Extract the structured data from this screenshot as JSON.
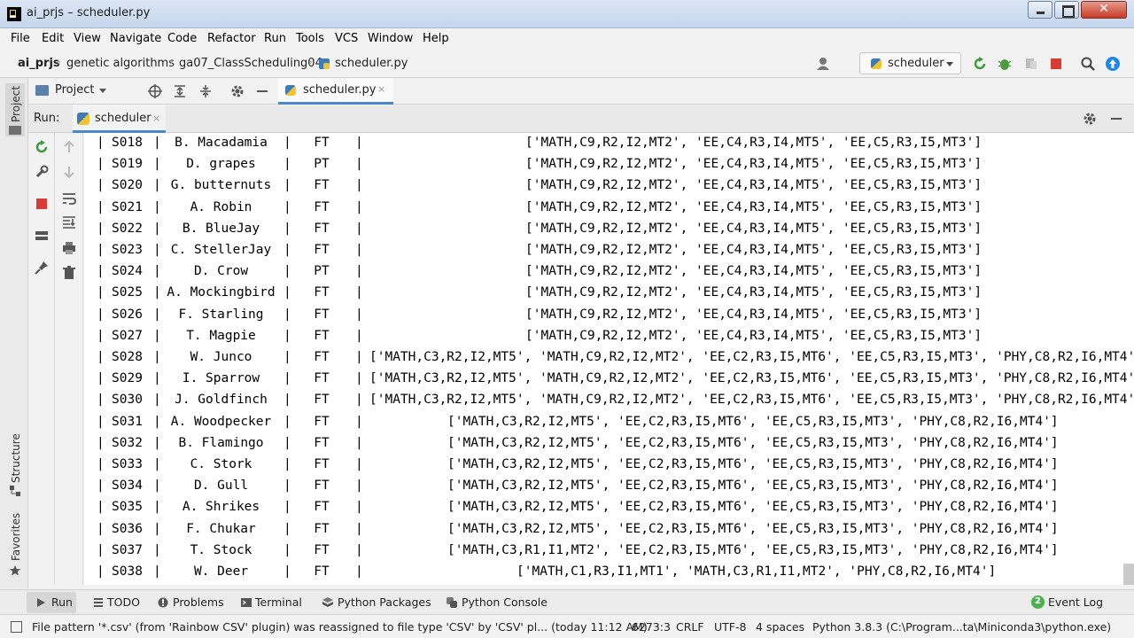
{
  "window": {
    "title": "ai_prjs – scheduler.py",
    "close_glyph": "✕"
  },
  "menu": [
    "File",
    "Edit",
    "View",
    "Navigate",
    "Code",
    "Refactor",
    "Run",
    "Tools",
    "VCS",
    "Window",
    "Help"
  ],
  "breadcrumb": [
    "ai_prjs",
    "genetic algorithms",
    "ga07_ClassScheduling04",
    "scheduler.py"
  ],
  "run_config": "scheduler",
  "left_strip": {
    "project": "Project",
    "structure": "Structure",
    "favorites": "Favorites"
  },
  "project_panel": {
    "label": "Project"
  },
  "editor_tab": {
    "label": "scheduler.py",
    "close": "×"
  },
  "run_panel": {
    "label": "Run:",
    "tab_label": "scheduler",
    "tab_close": "×"
  },
  "console_rows": [
    {
      "id": "S018",
      "name": "B. Macadamia",
      "type": "FT",
      "courses": "['MATH,C9,R2,I2,MT2', 'EE,C4,R3,I4,MT5', 'EE,C5,R3,I5,MT3']",
      "indent": 498
    },
    {
      "id": "S019",
      "name": "D. grapes",
      "type": "PT",
      "courses": "['MATH,C9,R2,I2,MT2', 'EE,C4,R3,I4,MT5', 'EE,C5,R3,I5,MT3']",
      "indent": 498
    },
    {
      "id": "S020",
      "name": "G. butternuts",
      "type": "FT",
      "courses": "['MATH,C9,R2,I2,MT2', 'EE,C4,R3,I4,MT5', 'EE,C5,R3,I5,MT3']",
      "indent": 498
    },
    {
      "id": "S021",
      "name": "A. Robin",
      "type": "FT",
      "courses": "['MATH,C9,R2,I2,MT2', 'EE,C4,R3,I4,MT5', 'EE,C5,R3,I5,MT3']",
      "indent": 498
    },
    {
      "id": "S022",
      "name": "B. BlueJay",
      "type": "FT",
      "courses": "['MATH,C9,R2,I2,MT2', 'EE,C4,R3,I4,MT5', 'EE,C5,R3,I5,MT3']",
      "indent": 498
    },
    {
      "id": "S023",
      "name": "C. StellerJay",
      "type": "FT",
      "courses": "['MATH,C9,R2,I2,MT2', 'EE,C4,R3,I4,MT5', 'EE,C5,R3,I5,MT3']",
      "indent": 498
    },
    {
      "id": "S024",
      "name": "D. Crow",
      "type": "PT",
      "courses": "['MATH,C9,R2,I2,MT2', 'EE,C4,R3,I4,MT5', 'EE,C5,R3,I5,MT3']",
      "indent": 498
    },
    {
      "id": "S025",
      "name": "A. Mockingbird",
      "type": "FT",
      "courses": "['MATH,C9,R2,I2,MT2', 'EE,C4,R3,I4,MT5', 'EE,C5,R3,I5,MT3']",
      "indent": 498
    },
    {
      "id": "S026",
      "name": "F. Starling",
      "type": "FT",
      "courses": "['MATH,C9,R2,I2,MT2', 'EE,C4,R3,I4,MT5', 'EE,C5,R3,I5,MT3']",
      "indent": 498
    },
    {
      "id": "S027",
      "name": "T. Magpie",
      "type": "FT",
      "courses": "['MATH,C9,R2,I2,MT2', 'EE,C4,R3,I4,MT5', 'EE,C5,R3,I5,MT3']",
      "indent": 498
    },
    {
      "id": "S028",
      "name": "W. Junco",
      "type": "FT",
      "courses": "['MATH,C3,R2,I2,MT5', 'MATH,C9,R2,I2,MT2', 'EE,C2,R3,I5,MT6', 'EE,C5,R3,I5,MT3', 'PHY,C8,R2,I6,MT4']",
      "indent": 322
    },
    {
      "id": "S029",
      "name": "I. Sparrow",
      "type": "FT",
      "courses": "['MATH,C3,R2,I2,MT5', 'MATH,C9,R2,I2,MT2', 'EE,C2,R3,I5,MT6', 'EE,C5,R3,I5,MT3', 'PHY,C8,R2,I6,MT4']",
      "indent": 322
    },
    {
      "id": "S030",
      "name": "J. Goldfinch",
      "type": "FT",
      "courses": "['MATH,C3,R2,I2,MT5', 'MATH,C9,R2,I2,MT2', 'EE,C2,R3,I5,MT6', 'EE,C5,R3,I5,MT3', 'PHY,C8,R2,I6,MT4']",
      "indent": 322
    },
    {
      "id": "S031",
      "name": "A. Woodpecker",
      "type": "FT",
      "courses": "['MATH,C3,R2,I2,MT5', 'EE,C2,R3,I5,MT6', 'EE,C5,R3,I5,MT3', 'PHY,C8,R2,I6,MT4']",
      "indent": 410
    },
    {
      "id": "S032",
      "name": "B. Flamingo",
      "type": "FT",
      "courses": "['MATH,C3,R2,I2,MT5', 'EE,C2,R3,I5,MT6', 'EE,C5,R3,I5,MT3', 'PHY,C8,R2,I6,MT4']",
      "indent": 410
    },
    {
      "id": "S033",
      "name": "C. Stork",
      "type": "FT",
      "courses": "['MATH,C3,R2,I2,MT5', 'EE,C2,R3,I5,MT6', 'EE,C5,R3,I5,MT3', 'PHY,C8,R2,I6,MT4']",
      "indent": 410
    },
    {
      "id": "S034",
      "name": "D. Gull",
      "type": "FT",
      "courses": "['MATH,C3,R2,I2,MT5', 'EE,C2,R3,I5,MT6', 'EE,C5,R3,I5,MT3', 'PHY,C8,R2,I6,MT4']",
      "indent": 410
    },
    {
      "id": "S035",
      "name": "A. Shrikes",
      "type": "FT",
      "courses": "['MATH,C3,R2,I2,MT5', 'EE,C2,R3,I5,MT6', 'EE,C5,R3,I5,MT3', 'PHY,C8,R2,I6,MT4']",
      "indent": 410
    },
    {
      "id": "S036",
      "name": "F. Chukar",
      "type": "FT",
      "courses": "['MATH,C3,R2,I2,MT5', 'EE,C2,R3,I5,MT6', 'EE,C5,R3,I5,MT3', 'PHY,C8,R2,I6,MT4']",
      "indent": 410
    },
    {
      "id": "S037",
      "name": "T. Stock",
      "type": "FT",
      "courses": "['MATH,C3,R1,I1,MT2', 'EE,C2,R3,I5,MT6', 'EE,C5,R3,I5,MT3', 'PHY,C8,R2,I6,MT4']",
      "indent": 410
    },
    {
      "id": "S038",
      "name": "W. Deer",
      "type": "FT",
      "courses": "['MATH,C1,R3,I1,MT1', 'MATH,C3,R1,I1,MT2', 'PHY,C8,R2,I6,MT4']",
      "indent": 488
    }
  ],
  "bottom_tabs": [
    "Run",
    "TODO",
    "Problems",
    "Terminal",
    "Python Packages",
    "Python Console"
  ],
  "event_log": {
    "count": "2",
    "label": "Event Log"
  },
  "status": {
    "message": "File pattern '*.csv' (from 'Rainbow CSV' plugin) was reassigned to file type 'CSV' by 'CSV' pl... (today 11:12 AM)",
    "position": "6273:3",
    "line_sep": "CRLF",
    "encoding": "UTF-8",
    "indent": "4 spaces",
    "interpreter": "Python 3.8.3 (C:\\Program...ta\\Miniconda3\\python.exe)"
  }
}
